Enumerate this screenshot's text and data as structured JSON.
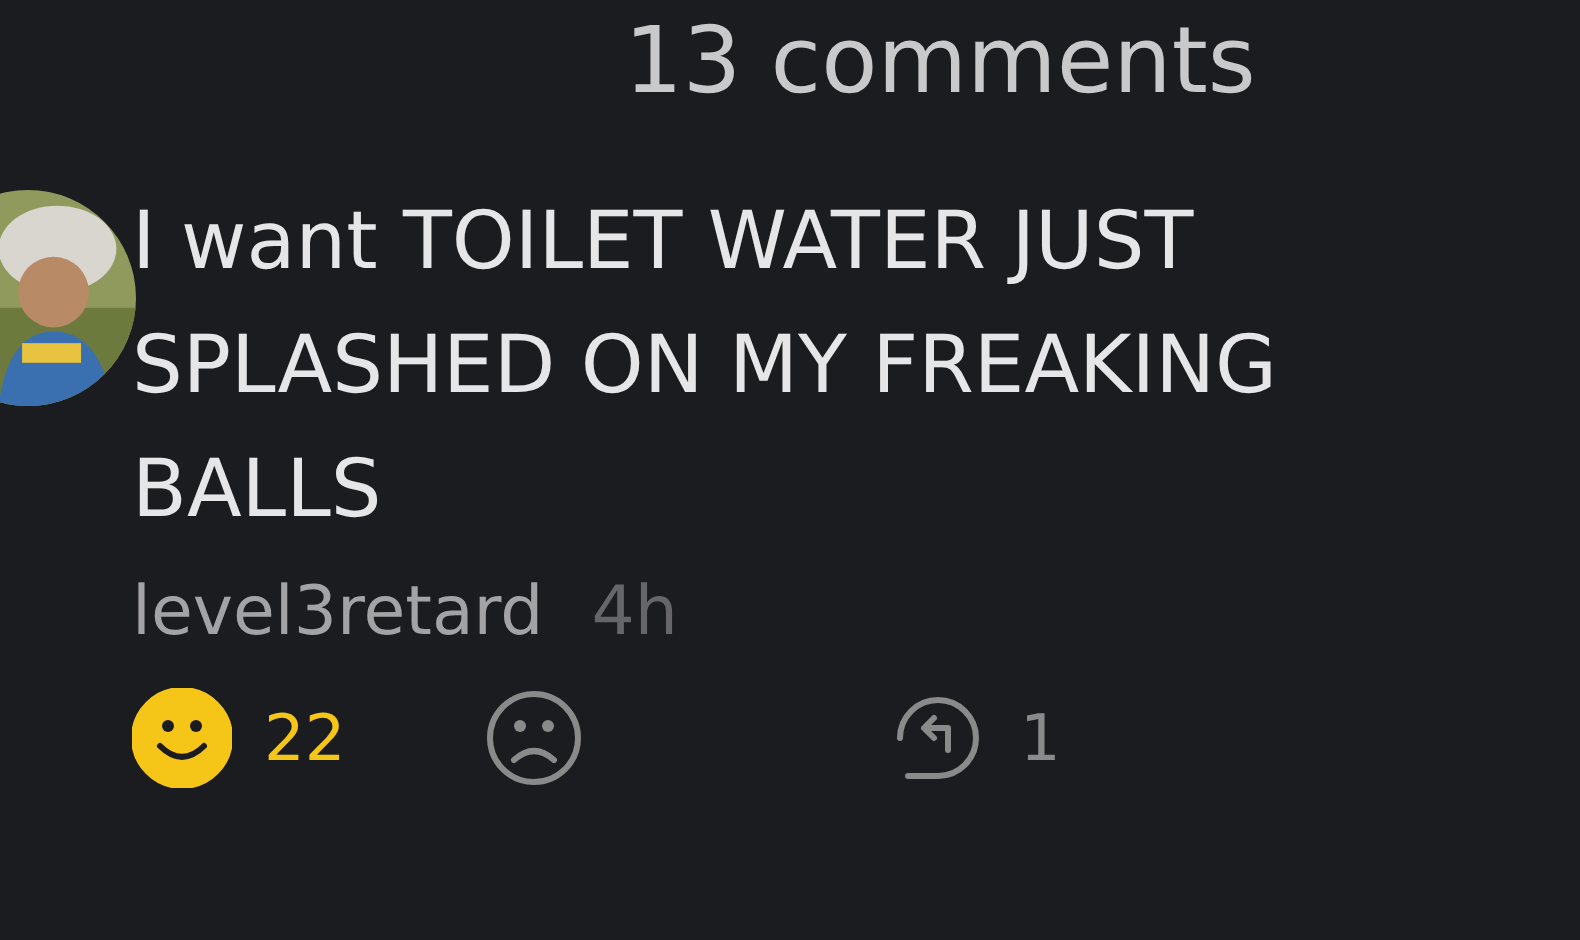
{
  "header": {
    "title": "13 comments"
  },
  "comment": {
    "text": "I want TOILET WATER JUST SPLASHED ON MY FREAKING BALLS",
    "author": "level3retard",
    "time": "4h",
    "reactions": [
      {
        "kind": "smile",
        "selected": true,
        "count": "22"
      },
      {
        "kind": "frown",
        "selected": false
      },
      {
        "kind": "reply",
        "selected": false,
        "count": "1"
      }
    ]
  }
}
